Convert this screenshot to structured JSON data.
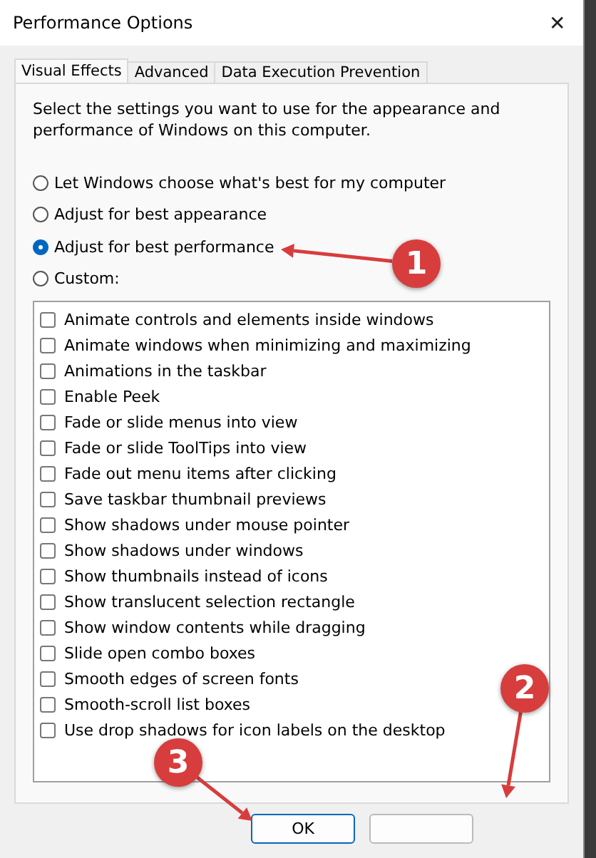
{
  "window": {
    "title": "Performance Options",
    "close": "✕"
  },
  "tabs": [
    {
      "label": "Visual Effects",
      "selected": true
    },
    {
      "label": "Advanced",
      "selected": false
    },
    {
      "label": "Data Execution Prevention",
      "selected": false
    }
  ],
  "intro": "Select the settings you want to use for the appearance and performance of Windows on this computer.",
  "options": [
    {
      "label": "Let Windows choose what's best for my computer",
      "selected": false
    },
    {
      "label": "Adjust for best appearance",
      "selected": false
    },
    {
      "label": "Adjust for best performance",
      "selected": true
    },
    {
      "label": "Custom:",
      "selected": false
    }
  ],
  "effects": [
    {
      "label": "Animate controls and elements inside windows",
      "checked": false
    },
    {
      "label": "Animate windows when minimizing and maximizing",
      "checked": false
    },
    {
      "label": "Animations in the taskbar",
      "checked": false
    },
    {
      "label": "Enable Peek",
      "checked": false
    },
    {
      "label": "Fade or slide menus into view",
      "checked": false
    },
    {
      "label": "Fade or slide ToolTips into view",
      "checked": false
    },
    {
      "label": "Fade out menu items after clicking",
      "checked": false
    },
    {
      "label": "Save taskbar thumbnail previews",
      "checked": false
    },
    {
      "label": "Show shadows under mouse pointer",
      "checked": false
    },
    {
      "label": "Show shadows under windows",
      "checked": false
    },
    {
      "label": "Show thumbnails instead of icons",
      "checked": false
    },
    {
      "label": "Show translucent selection rectangle",
      "checked": false
    },
    {
      "label": "Show window contents while dragging",
      "checked": false
    },
    {
      "label": "Slide open combo boxes",
      "checked": false
    },
    {
      "label": "Smooth edges of screen fonts",
      "checked": false
    },
    {
      "label": "Smooth-scroll list boxes",
      "checked": false
    },
    {
      "label": "Use drop shadows for icon labels on the desktop",
      "checked": false
    }
  ],
  "buttons": [
    {
      "label": "OK",
      "default": true
    },
    {
      "default": false
    }
  ],
  "callouts": [
    {
      "number": "1"
    },
    {
      "number": "2"
    },
    {
      "number": "3"
    }
  ]
}
